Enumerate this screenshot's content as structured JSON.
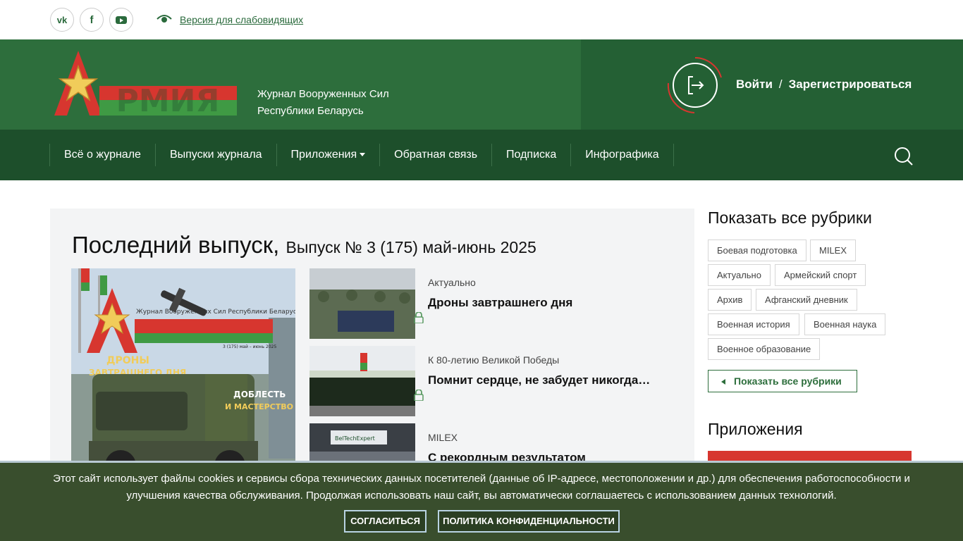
{
  "topbar": {
    "social": [
      {
        "name": "vk",
        "glyph": "vk"
      },
      {
        "name": "facebook",
        "glyph": "f"
      },
      {
        "name": "youtube",
        "glyph": ""
      }
    ],
    "low_vision_label": "Версия для слабовидящих"
  },
  "header": {
    "logo_text": "АРМИЯ",
    "tagline_line1": "Журнал Вооруженных Сил",
    "tagline_line2": "Республики Беларусь",
    "login_label": "Войти",
    "separator": "/",
    "register_label": "Зарегистрироваться"
  },
  "nav": {
    "items": [
      {
        "label": "Всё о журнале"
      },
      {
        "label": "Выпуски журнала"
      },
      {
        "label": "Приложения",
        "dropdown": true
      },
      {
        "label": "Обратная связь"
      },
      {
        "label": "Подписка"
      },
      {
        "label": "Инфографика"
      }
    ]
  },
  "latest": {
    "title": "Последний выпуск,",
    "issue": "Выпуск № 3 (175) май-июнь 2025",
    "cover": {
      "logo": "АРМИЯ",
      "header_text": "Журнал Вооруженных Сил Республики Беларусь",
      "issue_line": "3 (175) май – июнь 2025",
      "headline1": "ДРОНЫ",
      "headline2": "ЗАВТРАШНЕГО ДНЯ",
      "headline3": "ДОБЛЕСТЬ",
      "headline4": "И МАСТЕРСТВО"
    },
    "articles": [
      {
        "category": "Актуально",
        "title": "Дроны завтрашнего дня"
      },
      {
        "category": "К 80-летию Великой Победы",
        "title": "Помнит сердце, не забудет никогда…"
      },
      {
        "category": "MILEX",
        "title": "С рекордным результатом",
        "thumb_text": "BelTechExpert"
      }
    ]
  },
  "sidebar": {
    "rubrics_title": "Показать все рубрики",
    "tags": [
      "Боевая подготовка",
      "MILEX",
      "Актуально",
      "Армейский спорт",
      "Архив",
      "Афганский дневник",
      "Военная история",
      "Военная наука",
      "Военное образование"
    ],
    "show_all_label": "Показать все рубрики",
    "apps_title": "Приложения"
  },
  "cookie": {
    "text": "Этот сайт использует файлы cookies и сервисы сбора технических данных посетителей (данные об IP-адресе, местоположении и др.) для обеспечения работоспособности и улучшения качества обслуживания. Продолжая использовать наш сайт, вы автоматически соглашаетесь с использованием данных технологий.",
    "agree_label": "СОГЛАСИТЬСЯ",
    "policy_label": "ПОЛИТИКА КОНФИДЕНЦИАЛЬНОСТИ"
  },
  "colors": {
    "header_green": "#2d6e3c",
    "nav_green": "#1d4f2b",
    "accent_red": "#d7362f",
    "cookie_bg": "#394e2d"
  }
}
